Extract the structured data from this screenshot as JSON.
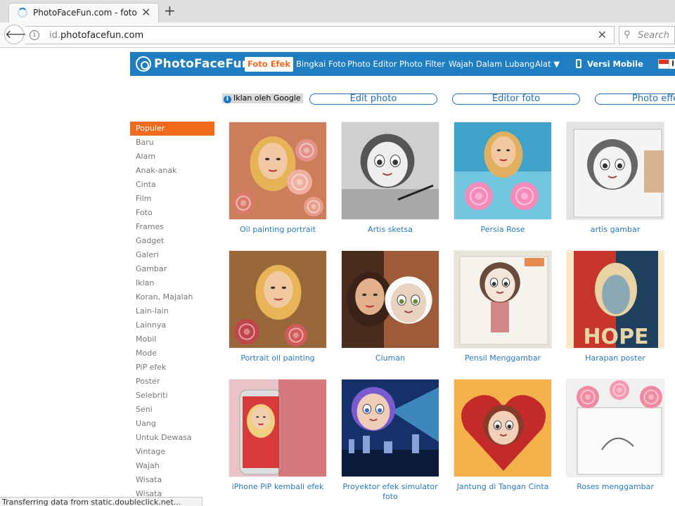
{
  "browser": {
    "tab_title": "PhotoFaceFun.com - foto ...",
    "url_prefix": "id.",
    "url_domain": "photofacefun.com",
    "search_placeholder": "Search",
    "status_text": "Transferring data from static.doubleclick.net..."
  },
  "site": {
    "logo": "PhotoFaceFun",
    "nav": [
      "Foto Efek",
      "Bingkai Foto",
      "Photo Editor",
      "Photo Filter",
      "Wajah Dalam Lubang",
      "Alat ▼"
    ],
    "mobile": "Versi Mobile",
    "lang": "I",
    "colors": {
      "brand_blue": "#1f7ec2",
      "accent_orange": "#f26b1d",
      "link_blue": "#2a7ab8"
    }
  },
  "ads": {
    "badge": "Iklan oleh Google",
    "links": [
      "Edit photo",
      "Editor foto",
      "Photo effe"
    ]
  },
  "sidebar": {
    "categories": [
      "Populer",
      "Baru",
      "Alam",
      "Anak-anak",
      "Cinta",
      "Film",
      "Foto",
      "Frames",
      "Gadget",
      "Galeri",
      "Gambar",
      "Iklan",
      "Koran, Majalah",
      "Lain-lain",
      "Lainnya",
      "Mobil",
      "Mode",
      "PiP efek",
      "Poster",
      "Selebriti",
      "Seni",
      "Uang",
      "Untuk Dewasa",
      "Vintage",
      "Wajah",
      "Wisata",
      "Wisata"
    ],
    "active_index": 0
  },
  "effects": [
    {
      "caption": "Oil painting portrait",
      "icon": "oil-painting-thumb"
    },
    {
      "caption": "Artis sketsa",
      "icon": "sketch-artist-thumb"
    },
    {
      "caption": "Persia Rose",
      "icon": "persia-rose-thumb"
    },
    {
      "caption": "artis gambar",
      "icon": "drawing-artist-thumb"
    },
    {
      "caption": "Portrait oil painting",
      "icon": "portrait-oil-thumb"
    },
    {
      "caption": "Ciuman",
      "icon": "kiss-thumb"
    },
    {
      "caption": "Pensil Menggambar",
      "icon": "pencil-drawing-thumb"
    },
    {
      "caption": "Harapan poster",
      "icon": "hope-poster-thumb",
      "poster_word": "HOPE"
    },
    {
      "caption": "iPhone PiP kembali efek",
      "icon": "iphone-pip-thumb"
    },
    {
      "caption": "Proyektor efek simulator foto",
      "icon": "projector-thumb"
    },
    {
      "caption": "Jantung di Tangan Cinta",
      "icon": "heart-hands-thumb"
    },
    {
      "caption": "Roses menggambar",
      "icon": "roses-drawing-thumb"
    }
  ]
}
